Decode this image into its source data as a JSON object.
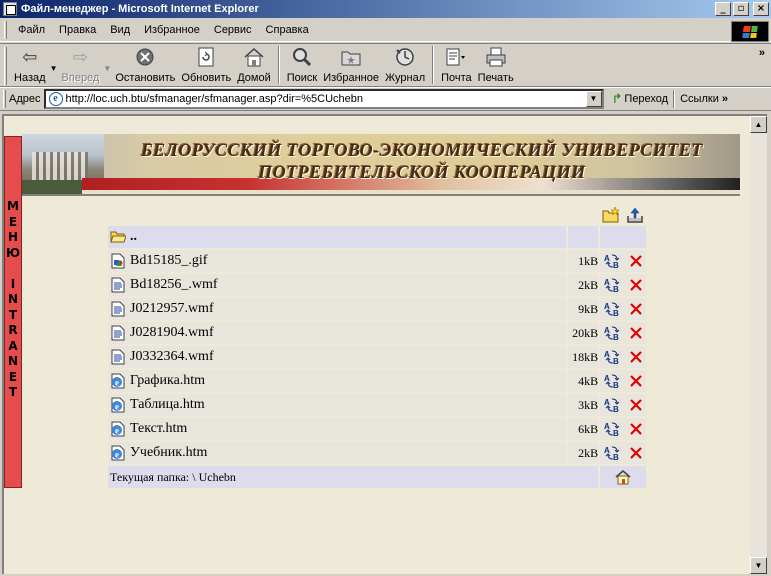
{
  "window": {
    "title": "Файл-менеджер - Microsoft Internet Explorer",
    "minimize": "_",
    "maximize": "▫",
    "close": "×"
  },
  "menu": {
    "file": "Файл",
    "edit": "Правка",
    "view": "Вид",
    "favorites": "Избранное",
    "tools": "Сервис",
    "help": "Справка"
  },
  "toolbar": {
    "back": "Назад",
    "forward": "Вперед",
    "stop": "Остановить",
    "refresh": "Обновить",
    "home": "Домой",
    "search": "Поиск",
    "favorites": "Избранное",
    "history": "Журнал",
    "mail": "Почта",
    "print": "Печать",
    "more": "»"
  },
  "address": {
    "label": "Адрес",
    "url": "http://loc.uch.btu/sfmanager/sfmanager.asp?dir=%5CUchebn",
    "go": "Переход",
    "links": "Ссылки",
    "links_more": "»"
  },
  "side_menu": {
    "letters": [
      "М",
      "Е",
      "Н",
      "Ю",
      " ",
      "I",
      "N",
      "T",
      "R",
      "A",
      "N",
      "E",
      "T"
    ],
    "color": "#e54d4d"
  },
  "banner": {
    "line1": "БЕЛОРУССКИЙ ТОРГОВО-ЭКОНОМИЧЕСКИЙ УНИВЕРСИТЕТ",
    "line2": "ПОТРЕБИТЕЛЬСКОЙ КООПЕРАЦИИ"
  },
  "files": {
    "up": "..",
    "items": [
      {
        "name": "Bd15185_.gif",
        "size": "1kB",
        "icon": "image-file-icon"
      },
      {
        "name": "Bd18256_.wmf",
        "size": "2kB",
        "icon": "document-file-icon"
      },
      {
        "name": "J0212957.wmf",
        "size": "9kB",
        "icon": "document-file-icon"
      },
      {
        "name": "J0281904.wmf",
        "size": "20kB",
        "icon": "document-file-icon"
      },
      {
        "name": "J0332364.wmf",
        "size": "18kB",
        "icon": "document-file-icon"
      },
      {
        "name": "Графика.htm",
        "size": "4kB",
        "icon": "ie-html-file-icon"
      },
      {
        "name": "Таблица.htm",
        "size": "3kB",
        "icon": "ie-html-file-icon"
      },
      {
        "name": "Текст.htm",
        "size": "6kB",
        "icon": "ie-html-file-icon"
      },
      {
        "name": "Учебник.htm",
        "size": "2kB",
        "icon": "ie-html-file-icon"
      }
    ],
    "current_folder": "Текущая папка: \\ Uchebn"
  },
  "colors": {
    "row_bg": "#e8e5dc",
    "header_row_bg": "#dcdcec",
    "delete_red": "#e00000",
    "page_bg": "#efead8"
  }
}
